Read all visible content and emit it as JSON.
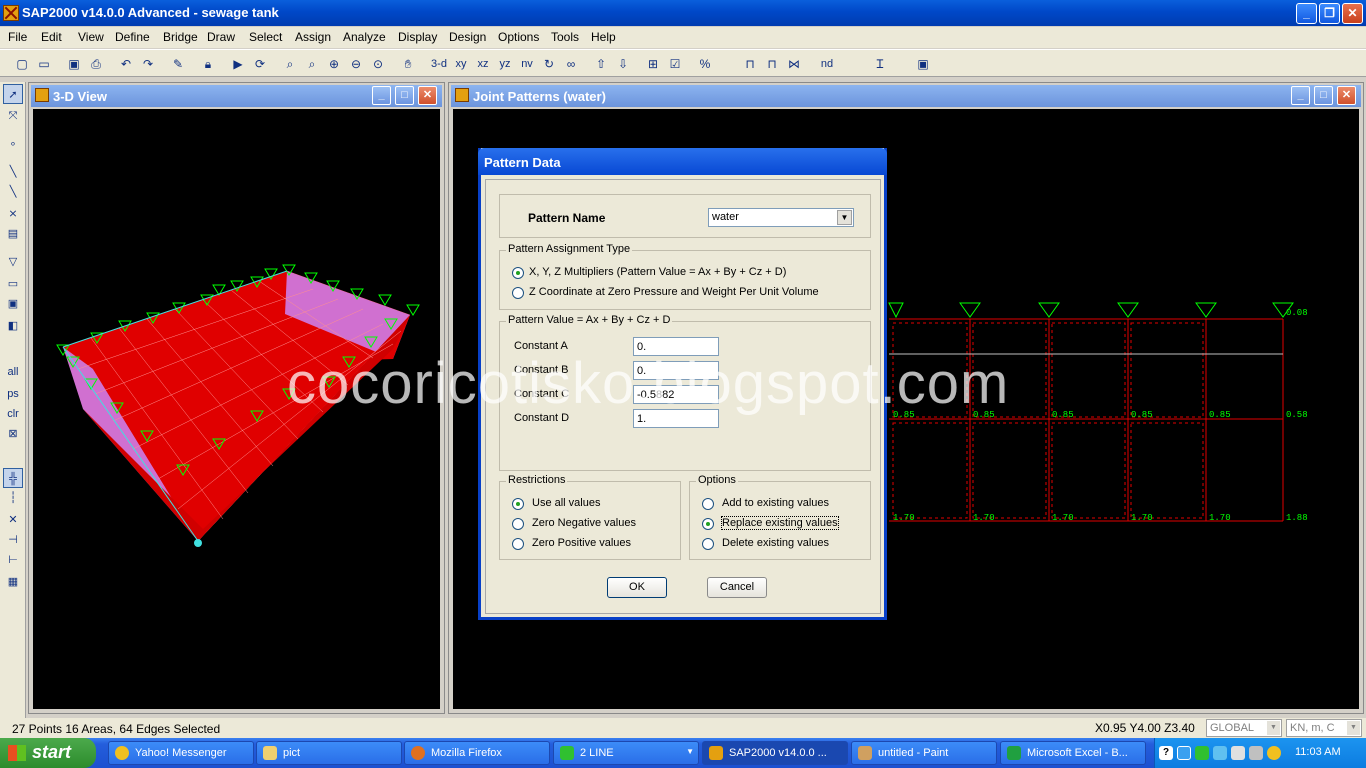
{
  "app": {
    "title": "SAP2000 v14.0.0 Advanced  - sewage tank"
  },
  "menu": [
    "File",
    "Edit",
    "View",
    "Define",
    "Bridge",
    "Draw",
    "Select",
    "Assign",
    "Analyze",
    "Display",
    "Design",
    "Options",
    "Tools",
    "Help"
  ],
  "toolbar": {
    "view_3d": "3-d",
    "view_xy": "xy",
    "view_xz": "xz",
    "view_yz": "yz",
    "view_nv": "nv",
    "view_nd": "nd"
  },
  "left_toolbar": {
    "all": "all",
    "ps": "ps",
    "clr": "clr"
  },
  "window_3d": {
    "title": "3-D View"
  },
  "window_joint": {
    "title": "Joint Patterns (water)",
    "top_labels": [
      "0.08"
    ],
    "row_mid": [
      "0.85",
      "0.85",
      "0.85",
      "0.85",
      "0.85",
      "0.58"
    ],
    "row_bottom": [
      "1.70",
      "1.70",
      "1.70",
      "1.70",
      "1.70",
      "1.88"
    ]
  },
  "watermark": "cocoricotisko.blogspot.com",
  "dialog": {
    "title": "Pattern Data",
    "pattern_name_label": "Pattern Name",
    "pattern_name_value": "water",
    "assignment_group": "Pattern Assignment Type",
    "assign_opt1": "X, Y, Z Multipliers  (Pattern Value = Ax + By + Cz + D)",
    "assign_opt2": "Z Coordinate at Zero Pressure and Weight Per Unit Volume",
    "value_group": "Pattern Value =  Ax + By + Cz + D",
    "const_a_label": "Constant  A",
    "const_b_label": "Constant  B",
    "const_c_label": "Constant  C",
    "const_d_label": "Constant  D",
    "const_a": "0.",
    "const_b": "0.",
    "const_c": "-0.5882",
    "const_d": "1.",
    "restrictions_group": "Restrictions",
    "restr_opt1": "Use all values",
    "restr_opt2": "Zero Negative values",
    "restr_opt3": "Zero Positive values",
    "options_group": "Options",
    "opt1": "Add to existing values",
    "opt2": "Replace existing values",
    "opt3": "Delete existing values",
    "ok": "OK",
    "cancel": "Cancel"
  },
  "status": {
    "selection": "27 Points  16 Areas, 64 Edges Selected",
    "coords": "X0.95  Y4.00  Z3.40",
    "coord_system": "GLOBAL",
    "units": "KN, m, C"
  },
  "taskbar": {
    "start": "start",
    "tasks": [
      "Yahoo! Messenger",
      "pict",
      "Mozilla Firefox",
      "2 LINE",
      "SAP2000 v14.0.0 ...",
      "untitled - Paint",
      "Microsoft Excel - B..."
    ],
    "clock": "11:03 AM"
  },
  "colors": {
    "accent": "#0848d4",
    "tank_red": "#e00000",
    "tank_pink": "#d070d0",
    "frame_green": "#00ff00"
  }
}
